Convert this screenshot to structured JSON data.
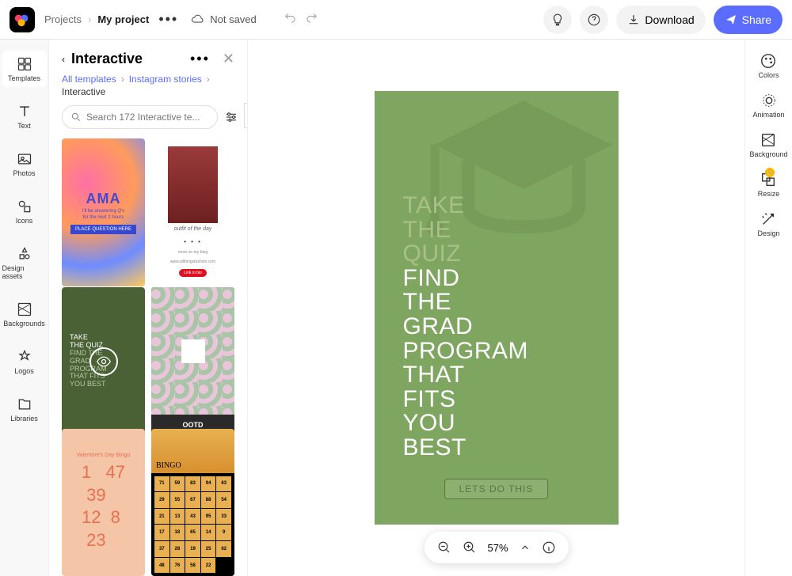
{
  "header": {
    "breadcrumb_root": "Projects",
    "breadcrumb_current": "My project",
    "save_status": "Not saved",
    "download_label": "Download",
    "share_label": "Share"
  },
  "left_rail": [
    {
      "label": "Templates"
    },
    {
      "label": "Text"
    },
    {
      "label": "Photos"
    },
    {
      "label": "Icons"
    },
    {
      "label": "Design assets"
    },
    {
      "label": "Backgrounds"
    },
    {
      "label": "Logos"
    },
    {
      "label": "Libraries"
    }
  ],
  "panel": {
    "title": "Interactive",
    "crumb1": "All templates",
    "crumb2": "Instagram stories",
    "sub": "Interactive",
    "search_placeholder": "Search 172 Interactive te...",
    "templates": {
      "ama_title": "AMA",
      "ama_sub1": "I'll be answering Q's",
      "ama_sub2": "for the next 2 hours",
      "ama_btn": "PLACE QUESTION HERE",
      "ootd_label": "outfit of the day",
      "ootd_line1": "more on my blog",
      "ootd_line2": "www.allthingsfashion.com",
      "ootd_btn": "Link in bio",
      "quiz_lines": [
        "TAKE",
        "THE QUIZ",
        "FIND THE",
        "GRAD",
        "PROGRAM",
        "THAT FITS",
        "YOU BEST"
      ],
      "ootd_black": "OOTD",
      "bingo_title": "Valentine's Day Bingo",
      "bingo_nums": [
        "1",
        "47",
        "39",
        "12",
        "8",
        "23"
      ],
      "halloween_bingo": "BINGO",
      "halloween_grid": [
        71,
        59,
        83,
        94,
        63,
        29,
        55,
        67,
        88,
        54,
        21,
        13,
        43,
        95,
        33,
        17,
        18,
        65,
        14,
        9,
        37,
        28,
        19,
        25,
        62,
        48,
        76,
        58,
        22
      ]
    }
  },
  "right_rail": [
    {
      "label": "Colors"
    },
    {
      "label": "Animation"
    },
    {
      "label": "Background"
    },
    {
      "label": "Resize"
    },
    {
      "label": "Design"
    }
  ],
  "canvas": {
    "lines_muted": [
      "TAKE",
      "THE",
      "QUIZ"
    ],
    "lines_white": [
      "FIND",
      "THE",
      "GRAD",
      "PROGRAM",
      "THAT",
      "FITS",
      "YOU",
      "BEST"
    ],
    "button_label": "LETS DO THIS"
  },
  "zoom": {
    "level": "57%"
  }
}
